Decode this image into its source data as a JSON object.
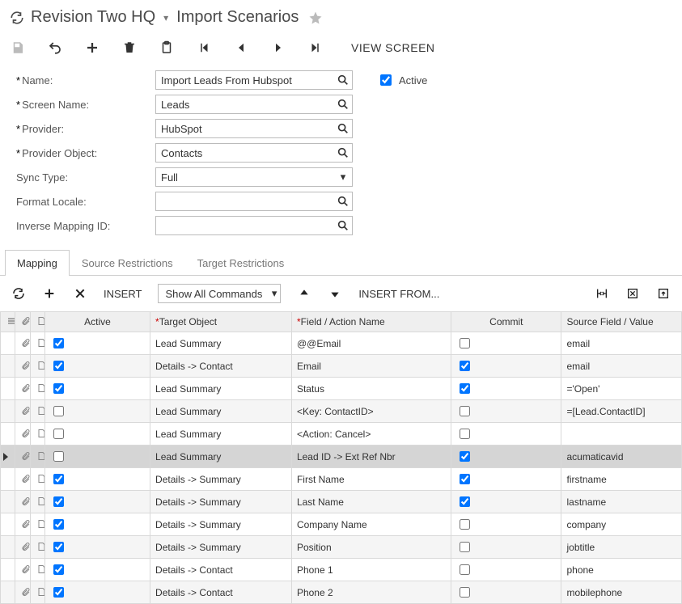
{
  "header": {
    "company": "Revision Two HQ",
    "page_title": "Import Scenarios"
  },
  "toolbar": {
    "view_screen": "VIEW SCREEN"
  },
  "form": {
    "labels": {
      "name": "Name:",
      "screen_name": "Screen Name:",
      "provider": "Provider:",
      "provider_object": "Provider Object:",
      "sync_type": "Sync Type:",
      "format_locale": "Format Locale:",
      "inverse_mapping": "Inverse Mapping ID:"
    },
    "values": {
      "name": "Import Leads From Hubspot",
      "screen_name": "Leads",
      "provider": "HubSpot",
      "provider_object": "Contacts",
      "sync_type": "Full",
      "format_locale": "",
      "inverse_mapping": ""
    },
    "active_label": "Active",
    "active_checked": true
  },
  "tabs": [
    {
      "label": "Mapping",
      "active": true
    },
    {
      "label": "Source Restrictions",
      "active": false
    },
    {
      "label": "Target Restrictions",
      "active": false
    }
  ],
  "subbar": {
    "insert": "INSERT",
    "filter_value": "Show All Commands",
    "insert_from": "INSERT FROM..."
  },
  "grid": {
    "headers": {
      "active": "Active",
      "target": "Target Object",
      "field": "Field / Action Name",
      "commit": "Commit",
      "source": "Source Field / Value"
    },
    "rows": [
      {
        "active": true,
        "target": "Lead Summary",
        "field": "@@Email",
        "commit": false,
        "source": "email",
        "selected": false
      },
      {
        "active": true,
        "target": "Details -> Contact",
        "field": "Email",
        "commit": true,
        "source": "email",
        "selected": false
      },
      {
        "active": true,
        "target": "Lead Summary",
        "field": "Status",
        "commit": true,
        "source": "='Open'",
        "selected": false
      },
      {
        "active": false,
        "target": "Lead Summary",
        "field": "<Key: ContactID>",
        "commit": false,
        "source": "=[Lead.ContactID]",
        "selected": false
      },
      {
        "active": false,
        "target": "Lead Summary",
        "field": "<Action: Cancel>",
        "commit": false,
        "source": "",
        "selected": false
      },
      {
        "active": false,
        "target": "Lead Summary",
        "field": "Lead ID -> Ext Ref Nbr",
        "commit": true,
        "source": "acumaticavid",
        "selected": true
      },
      {
        "active": true,
        "target": "Details -> Summary",
        "field": "First Name",
        "commit": true,
        "source": "firstname",
        "selected": false
      },
      {
        "active": true,
        "target": "Details -> Summary",
        "field": "Last Name",
        "commit": true,
        "source": "lastname",
        "selected": false
      },
      {
        "active": true,
        "target": "Details -> Summary",
        "field": "Company Name",
        "commit": false,
        "source": "company",
        "selected": false
      },
      {
        "active": true,
        "target": "Details -> Summary",
        "field": "Position",
        "commit": false,
        "source": "jobtitle",
        "selected": false
      },
      {
        "active": true,
        "target": "Details -> Contact",
        "field": "Phone 1",
        "commit": false,
        "source": "phone",
        "selected": false
      },
      {
        "active": true,
        "target": "Details -> Contact",
        "field": "Phone 2",
        "commit": false,
        "source": "mobilephone",
        "selected": false
      }
    ]
  }
}
